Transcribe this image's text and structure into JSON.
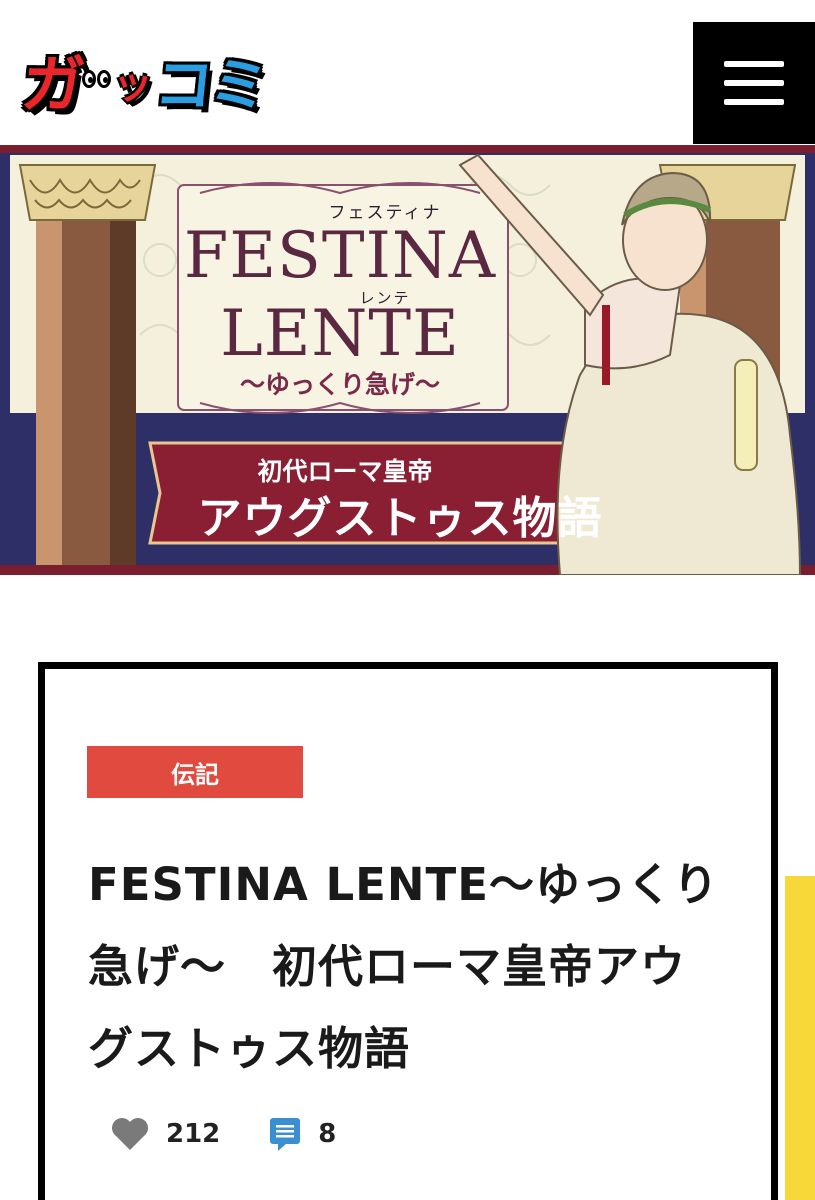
{
  "header": {
    "logo": {
      "part1": "ガ",
      "part2": "ッ",
      "part3": "コミ"
    },
    "menu_icon": "hamburger-menu-icon"
  },
  "banner": {
    "ruby_top": "フェスティナ",
    "title_line1": "FESTINA",
    "ruby_bottom": "レンテ",
    "title_line2": "LENTE",
    "subtitle": "〜ゆっくり急げ〜",
    "plate_small": "初代ローマ皇帝",
    "plate_large": "アウグストゥス物語"
  },
  "article": {
    "category": "伝記",
    "title": "FESTINA LENTE〜ゆっくり急げ〜　初代ローマ皇帝アウグストゥス物語",
    "likes": "212",
    "comments": "8",
    "like_icon": "heart-icon",
    "comment_icon": "comment-icon"
  },
  "colors": {
    "logo_red": "#e8262b",
    "logo_blue": "#2a9ee0",
    "tag_red": "#e04a3f",
    "accent_yellow": "#f8d838",
    "banner_purple": "#5a2840",
    "banner_plate": "#8a1f33"
  }
}
